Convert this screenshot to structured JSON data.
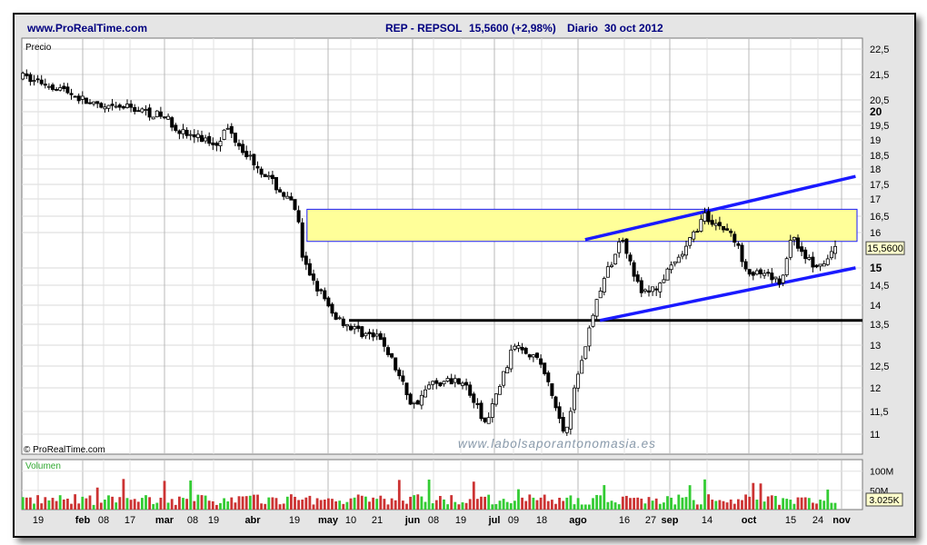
{
  "header": {
    "site": "www.ProRealTime.com",
    "symbol": "REP - REPSOL",
    "price": "15,5600 (+2,98%)",
    "period": "Diario",
    "date": "30 oct 2012"
  },
  "price_panel": {
    "label": "Precio",
    "copyright": "© ProRealTime.com",
    "watermark": "www.labolsaporantonomasia.es",
    "last_price_label": "15,5600"
  },
  "volume_panel": {
    "label": "Volumen",
    "last_volume_label": "3.025K"
  },
  "colors": {
    "background": "#e5e5e5",
    "plot": "#ffffff",
    "candle": "#000000",
    "channel": "#1a1aff",
    "support": "#000000",
    "resistance_zone": "#ffff99",
    "volume_up": "#33cc33",
    "volume_down": "#cc3333",
    "header_text": "#000080"
  },
  "chart_data": [
    {
      "type": "candlestick",
      "title": "REP - REPSOL",
      "ylabel": "Precio",
      "ylim": [
        10.7,
        22.8
      ],
      "yticks": [
        "22,5",
        "21,5",
        "20,5",
        "20",
        "19,5",
        "19",
        "18,5",
        "18",
        "17,5",
        "17",
        "16,5",
        "16",
        "15",
        "14,5",
        "14",
        "13,5",
        "13",
        "12,5",
        "12",
        "11,5",
        "11"
      ],
      "x_tick_labels": [
        "19",
        "feb",
        "08",
        "17",
        "mar",
        "08",
        "19",
        "abr",
        "19",
        "may",
        "10",
        "21",
        "jun",
        "08",
        "19",
        "jul",
        "09",
        "18",
        "ago",
        "16",
        "27",
        "sep",
        "14",
        "oct",
        "15",
        "24",
        "nov"
      ],
      "price_path": [
        {
          "x": "02 ene 2012",
          "y": 21.4
        },
        {
          "x": "20 ene 2012",
          "y": 21.0
        },
        {
          "x": "08 feb 2012",
          "y": 20.1
        },
        {
          "x": "17 feb 2012",
          "y": 20.2
        },
        {
          "x": "01 mar 2012",
          "y": 19.8
        },
        {
          "x": "08 mar 2012",
          "y": 19.2
        },
        {
          "x": "19 mar 2012",
          "y": 18.9
        },
        {
          "x": "23 mar 2012",
          "y": 19.4
        },
        {
          "x": "02 abr 2012",
          "y": 18.2
        },
        {
          "x": "19 abr 2012",
          "y": 16.6
        },
        {
          "x": "20 abr 2012",
          "y": 15.3
        },
        {
          "x": "02 may 2012",
          "y": 13.8
        },
        {
          "x": "10 may 2012",
          "y": 13.4
        },
        {
          "x": "21 may 2012",
          "y": 13.1
        },
        {
          "x": "01 jun 2012",
          "y": 11.6
        },
        {
          "x": "08 jun 2012",
          "y": 12.1
        },
        {
          "x": "19 jun 2012",
          "y": 12.2
        },
        {
          "x": "28 jun 2012",
          "y": 11.2
        },
        {
          "x": "09 jul 2012",
          "y": 13.1
        },
        {
          "x": "18 jul 2012",
          "y": 12.6
        },
        {
          "x": "27 jul 2012",
          "y": 11.0
        },
        {
          "x": "08 ago 2012",
          "y": 14.3
        },
        {
          "x": "16 ago 2012",
          "y": 15.9
        },
        {
          "x": "22 ago 2012",
          "y": 14.3
        },
        {
          "x": "27 ago 2012",
          "y": 14.4
        },
        {
          "x": "06 sep 2012",
          "y": 15.4
        },
        {
          "x": "14 sep 2012",
          "y": 16.5
        },
        {
          "x": "24 sep 2012",
          "y": 16.0
        },
        {
          "x": "01 oct 2012",
          "y": 14.9
        },
        {
          "x": "12 oct 2012",
          "y": 14.6
        },
        {
          "x": "15 oct 2012",
          "y": 15.9
        },
        {
          "x": "24 oct 2012",
          "y": 14.9
        },
        {
          "x": "30 oct 2012",
          "y": 15.56
        }
      ],
      "last_price": 15.56,
      "resistance_zone": [
        15.75,
        16.7
      ],
      "support_line": 13.6,
      "channel_upper": [
        {
          "x": "08 ago 2012",
          "y": 15.8
        },
        {
          "x": "30 oct 2012",
          "y": 17.7
        }
      ],
      "channel_lower": [
        {
          "x": "13 ago 2012",
          "y": 13.6
        },
        {
          "x": "30 oct 2012",
          "y": 14.95
        }
      ]
    },
    {
      "type": "bar",
      "title": "Volumen",
      "yticks": [
        "100M",
        "50M"
      ],
      "ylim": [
        0,
        130000000
      ],
      "last_value": "3.025K"
    }
  ]
}
